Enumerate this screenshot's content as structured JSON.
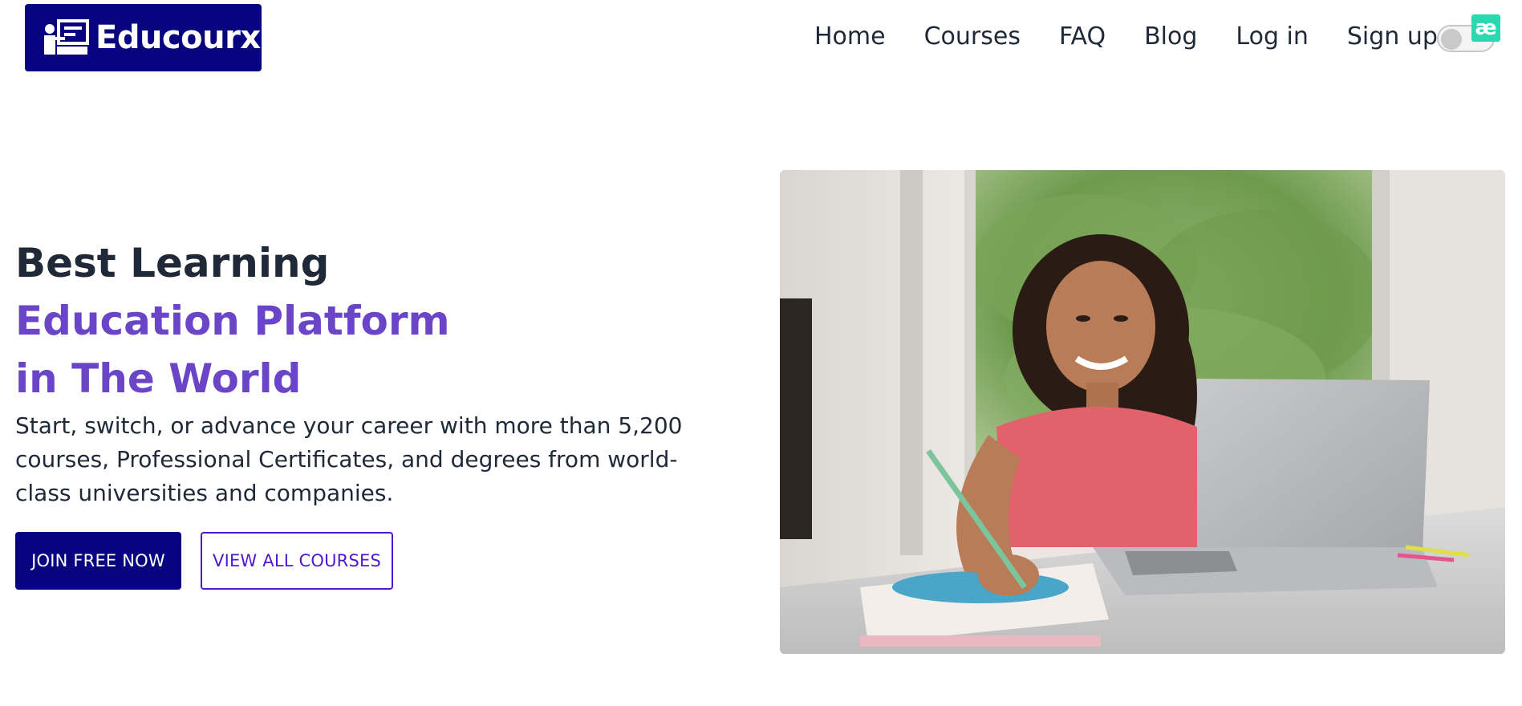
{
  "header": {
    "logo_text": "Educourx",
    "nav": [
      {
        "label": "Home"
      },
      {
        "label": "Courses"
      },
      {
        "label": "FAQ"
      },
      {
        "label": "Blog"
      },
      {
        "label": "Log in"
      },
      {
        "label": "Sign up"
      }
    ],
    "theme_toggle_state": "off",
    "badge_text": "æ"
  },
  "hero": {
    "title_line1": "Best Learning",
    "title_line2": "Education Platform",
    "title_line3": "in The World",
    "description": "Start, switch, or advance your career with more than 5,200 courses, Professional Certificates, and degrees from world-class universities and companies.",
    "primary_button": "JOIN FREE NOW",
    "secondary_button": "VIEW ALL COURSES",
    "image_icon": "girl-studying-laptop-photo"
  },
  "colors": {
    "brand_navy": "#08047f",
    "accent_purple": "#6a45c8",
    "outline_purple": "#4f18cf",
    "badge_teal": "#2bd9b0"
  }
}
